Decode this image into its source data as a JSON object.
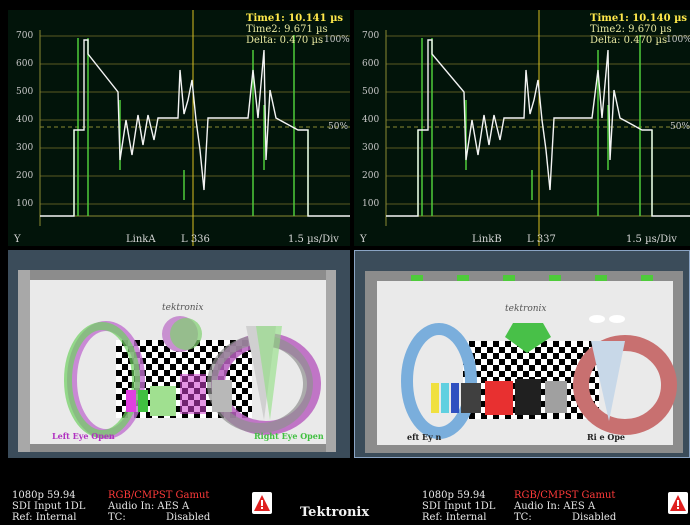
{
  "waveforms": [
    {
      "time1": "Time1: 10.141 µs",
      "time2": "Time2:  9.671 µs",
      "delta": "Delta:  0.470 µs",
      "delta_pct": "100%",
      "y_ticks": [
        "700",
        "600",
        "500",
        "400",
        "300",
        "200",
        "100"
      ],
      "mid_label": "50%",
      "link": "LinkA",
      "line": "L 336",
      "scale": "1.5 µs/Div",
      "ymark": "Y"
    },
    {
      "time1": "Time1: 10.140 µs",
      "time2": "Time2:  9.670 µs",
      "delta": "Delta:  0.470 µs",
      "delta_pct": "100%",
      "y_ticks": [
        "700",
        "600",
        "500",
        "400",
        "300",
        "200",
        "100"
      ],
      "mid_label": "50%",
      "link": "LinkB",
      "line": "L 337",
      "scale": "1.5 µs/Div",
      "ymark": "Y"
    }
  ],
  "pictures": [
    {
      "logo": "tektronix",
      "caption_left": "Left Eye Open",
      "caption_right": "Right Eye Open"
    },
    {
      "logo": "tektronix",
      "caption_left": "eft Ey     n",
      "caption_right": "Ri       e Ope"
    }
  ],
  "status": [
    {
      "format": "1080p 59.94",
      "input": "SDI Input 1DL",
      "ref": "Ref: Internal",
      "gamut": "RGB/CMPST Gamut",
      "audio": "Audio In: AES A",
      "tc_label": "TC:",
      "tc_value": "Disabled"
    },
    {
      "format": "1080p 59.94",
      "input": "SDI Input 1DL",
      "ref": "Ref: Internal",
      "gamut": "RGB/CMPST Gamut",
      "audio": "Audio In: AES A",
      "tc_label": "TC:",
      "tc_value": "Disabled"
    }
  ],
  "brand": "Tektronix",
  "colors": {
    "trace": "#f4f4f4",
    "trace_green": "#4ecb3a",
    "grid": "#6a6a2a",
    "cursor": "#d8c020",
    "alarm": "#ff3a3a"
  }
}
